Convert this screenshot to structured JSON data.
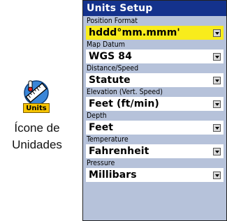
{
  "icon": {
    "badge_label": "Units",
    "caption": "Ícone de Unidades"
  },
  "units_setup": {
    "title": "Units Setup",
    "fields": [
      {
        "label": "Position Format",
        "value": "hddd°mm.mmm'",
        "selected": true
      },
      {
        "label": "Map Datum",
        "value": "WGS 84",
        "selected": false
      },
      {
        "label": "Distance/Speed",
        "value": "Statute",
        "selected": false
      },
      {
        "label": "Elevation (Vert. Speed)",
        "value": "Feet (ft/min)",
        "selected": false
      },
      {
        "label": "Depth",
        "value": "Feet",
        "selected": false
      },
      {
        "label": "Temperature",
        "value": "Fahrenheit",
        "selected": false
      },
      {
        "label": "Pressure",
        "value": "Millibars",
        "selected": false
      }
    ]
  },
  "colors": {
    "title_bar": "#14328c",
    "panel_bg": "#b6c2da",
    "selected_row": "#f8ec1c",
    "badge": "#f6c400"
  }
}
